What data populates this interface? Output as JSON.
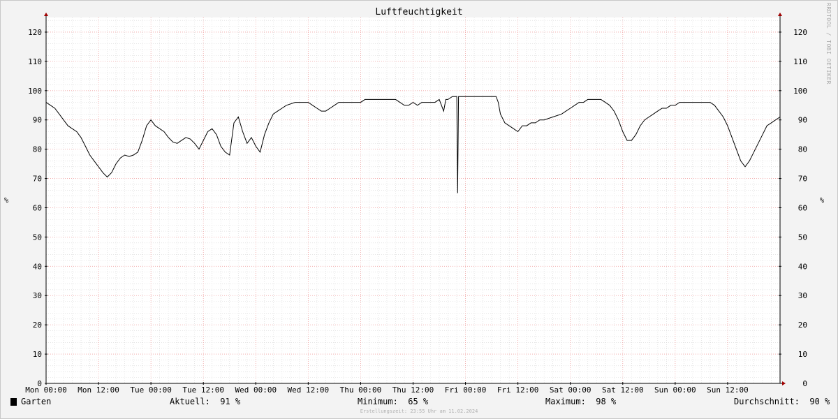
{
  "chart_data": {
    "type": "line",
    "title": "Luftfeuchtigkeit",
    "ylabel": "%",
    "ylim": [
      0,
      125
    ],
    "yticks": [
      0,
      10,
      20,
      30,
      40,
      50,
      60,
      70,
      80,
      90,
      100,
      110,
      120
    ],
    "x_range_hours": [
      0,
      168
    ],
    "xticks": [
      {
        "label": "Mon 00:00",
        "h": 0
      },
      {
        "label": "Mon 12:00",
        "h": 12
      },
      {
        "label": "Tue 00:00",
        "h": 24
      },
      {
        "label": "Tue 12:00",
        "h": 36
      },
      {
        "label": "Wed 00:00",
        "h": 48
      },
      {
        "label": "Wed 12:00",
        "h": 60
      },
      {
        "label": "Thu 00:00",
        "h": 72
      },
      {
        "label": "Thu 12:00",
        "h": 84
      },
      {
        "label": "Fri 00:00",
        "h": 96
      },
      {
        "label": "Fri 12:00",
        "h": 108
      },
      {
        "label": "Sat 00:00",
        "h": 120
      },
      {
        "label": "Sat 12:00",
        "h": 132
      },
      {
        "label": "Sun 00:00",
        "h": 144
      },
      {
        "label": "Sun 12:00",
        "h": 156
      }
    ],
    "grid": true,
    "series": [
      {
        "name": "Garten",
        "color": "#000000",
        "points": [
          [
            0,
            96
          ],
          [
            1,
            95
          ],
          [
            2,
            94
          ],
          [
            3,
            92
          ],
          [
            4,
            90
          ],
          [
            5,
            88
          ],
          [
            6,
            87
          ],
          [
            7,
            86
          ],
          [
            8,
            84
          ],
          [
            9,
            81
          ],
          [
            10,
            78
          ],
          [
            11,
            76
          ],
          [
            12,
            74
          ],
          [
            13,
            72
          ],
          [
            14,
            70.5
          ],
          [
            15,
            72
          ],
          [
            16,
            75
          ],
          [
            17,
            77
          ],
          [
            18,
            78
          ],
          [
            19,
            77.5
          ],
          [
            20,
            78
          ],
          [
            21,
            79
          ],
          [
            22,
            83
          ],
          [
            23,
            88
          ],
          [
            24,
            90
          ],
          [
            25,
            88
          ],
          [
            26,
            87
          ],
          [
            27,
            86
          ],
          [
            28,
            84
          ],
          [
            29,
            82.5
          ],
          [
            30,
            82
          ],
          [
            31,
            83
          ],
          [
            32,
            84
          ],
          [
            33,
            83.5
          ],
          [
            34,
            82
          ],
          [
            35,
            80
          ],
          [
            36,
            83
          ],
          [
            37,
            86
          ],
          [
            38,
            87
          ],
          [
            39,
            85
          ],
          [
            40,
            81
          ],
          [
            41,
            79
          ],
          [
            42,
            78
          ],
          [
            43,
            89
          ],
          [
            44,
            91
          ],
          [
            45,
            86
          ],
          [
            46,
            82
          ],
          [
            47,
            84
          ],
          [
            48,
            81
          ],
          [
            49,
            79
          ],
          [
            50,
            85
          ],
          [
            51,
            89
          ],
          [
            52,
            92
          ],
          [
            53,
            93
          ],
          [
            54,
            94
          ],
          [
            55,
            95
          ],
          [
            57,
            96
          ],
          [
            59,
            96
          ],
          [
            60,
            96
          ],
          [
            61,
            95
          ],
          [
            62,
            94
          ],
          [
            63,
            93
          ],
          [
            64,
            93
          ],
          [
            65,
            94
          ],
          [
            66,
            95
          ],
          [
            67,
            96
          ],
          [
            69,
            96
          ],
          [
            70,
            96
          ],
          [
            71,
            96
          ],
          [
            72,
            96
          ],
          [
            73,
            97
          ],
          [
            75,
            97
          ],
          [
            78,
            97
          ],
          [
            80,
            97
          ],
          [
            81,
            96
          ],
          [
            82,
            95
          ],
          [
            83,
            95
          ],
          [
            84,
            96
          ],
          [
            85,
            95
          ],
          [
            86,
            96
          ],
          [
            88,
            96
          ],
          [
            89,
            96
          ],
          [
            90,
            97
          ],
          [
            91,
            93
          ],
          [
            91.5,
            97
          ],
          [
            92,
            97
          ],
          [
            93,
            98
          ],
          [
            94,
            98
          ],
          [
            94.2,
            65
          ],
          [
            94.4,
            98
          ],
          [
            96,
            98
          ],
          [
            98,
            98
          ],
          [
            100,
            98
          ],
          [
            102,
            98
          ],
          [
            103,
            98
          ],
          [
            103.5,
            96
          ],
          [
            104,
            92
          ],
          [
            105,
            89
          ],
          [
            106,
            88
          ],
          [
            107,
            87
          ],
          [
            108,
            86
          ],
          [
            109,
            88
          ],
          [
            110,
            88
          ],
          [
            111,
            89
          ],
          [
            112,
            89
          ],
          [
            113,
            90
          ],
          [
            114,
            90
          ],
          [
            116,
            91
          ],
          [
            118,
            92
          ],
          [
            119,
            93
          ],
          [
            120,
            94
          ],
          [
            121,
            95
          ],
          [
            122,
            96
          ],
          [
            123,
            96
          ],
          [
            124,
            97
          ],
          [
            125,
            97
          ],
          [
            126,
            97
          ],
          [
            127,
            97
          ],
          [
            128,
            96
          ],
          [
            129,
            95
          ],
          [
            130,
            93
          ],
          [
            131,
            90
          ],
          [
            132,
            86
          ],
          [
            133,
            83
          ],
          [
            134,
            83
          ],
          [
            135,
            85
          ],
          [
            136,
            88
          ],
          [
            137,
            90
          ],
          [
            138,
            91
          ],
          [
            139,
            92
          ],
          [
            140,
            93
          ],
          [
            141,
            94
          ],
          [
            142,
            94
          ],
          [
            143,
            95
          ],
          [
            144,
            95
          ],
          [
            145,
            96
          ],
          [
            147,
            96
          ],
          [
            150,
            96
          ],
          [
            152,
            96
          ],
          [
            153,
            95
          ],
          [
            154,
            93
          ],
          [
            155,
            91
          ],
          [
            156,
            88
          ],
          [
            157,
            84
          ],
          [
            158,
            80
          ],
          [
            159,
            76
          ],
          [
            160,
            74
          ],
          [
            161,
            76
          ],
          [
            162,
            79
          ],
          [
            163,
            82
          ],
          [
            164,
            85
          ],
          [
            165,
            88
          ],
          [
            166,
            89
          ],
          [
            167,
            90
          ],
          [
            168,
            91
          ]
        ]
      }
    ]
  },
  "legend": {
    "series_label": "Garten",
    "current": "Aktuell:  91 %",
    "minimum": "Minimum:  65 %",
    "maximum": "Maximum:  98 %",
    "average": "Durchschnitt:  90 %"
  },
  "footer": "Erstellungszeit: 23:55 Uhr am 11.02.2024",
  "watermark": "RRDTOOL / TOBI OETIKER",
  "colors": {
    "major_grid": "#f0a0a0",
    "minor_grid": "#d6d6d6",
    "axis_arrow": "#a00000",
    "plot_background": "#ffffff",
    "page_background": "#f3f3f3"
  }
}
